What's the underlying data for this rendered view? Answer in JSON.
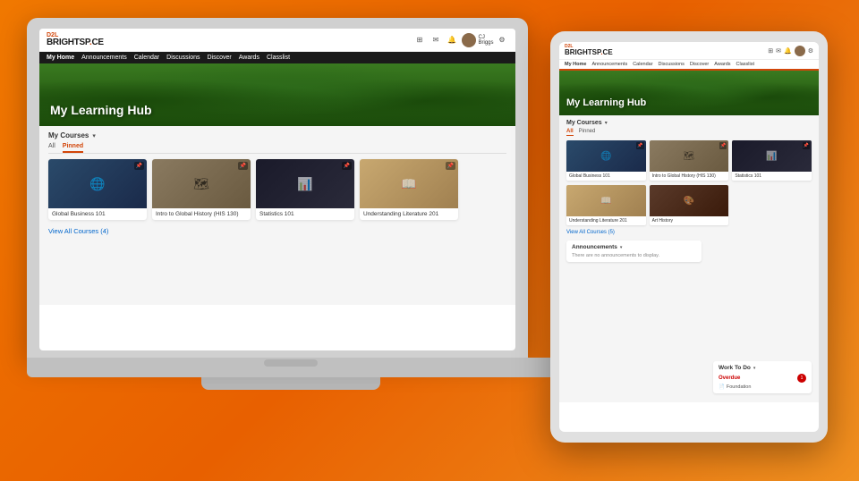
{
  "background": {
    "color": "#f07800"
  },
  "laptop": {
    "header": {
      "logo_d2l": "D2L",
      "logo_name": "BRIGHTSP",
      "logo_dot": ".",
      "logo_ce": "CE",
      "icons": [
        "grid",
        "mail",
        "bell",
        "avatar",
        "gear"
      ]
    },
    "nav": {
      "items": [
        "My Home",
        "Announcements",
        "Calendar",
        "Discussions",
        "Discover",
        "Awards",
        "Classlist"
      ]
    },
    "hero": {
      "title": "My Learning Hub"
    },
    "courses": {
      "section_title": "My Courses",
      "tabs": [
        "All",
        "Pinned"
      ],
      "active_tab": "Pinned",
      "items": [
        {
          "name": "Global Business 101",
          "thumb": "business"
        },
        {
          "name": "Intro to Global History (HIS 130)",
          "thumb": "history"
        },
        {
          "name": "Statistics 101",
          "thumb": "stats"
        },
        {
          "name": "Understanding Literature 201",
          "thumb": "literature"
        }
      ],
      "view_all": "View All Courses (4)"
    }
  },
  "tablet": {
    "header": {
      "logo_d2l": "D2L",
      "logo_name": "BRIGHTSP",
      "logo_dot": ".",
      "logo_ce": "CE",
      "icons": [
        "grid",
        "mail",
        "bell",
        "avatar",
        "gear"
      ]
    },
    "nav": {
      "items": [
        "My Home",
        "Announcements",
        "Calendar",
        "Discussions",
        "Discover",
        "Awards",
        "Classlist"
      ]
    },
    "hero": {
      "title": "My Learning Hub"
    },
    "courses": {
      "section_title": "My Courses",
      "tabs": [
        "All",
        "Pinned"
      ],
      "active_tab": "All",
      "row1": [
        {
          "name": "Global Business 101",
          "thumb": "business"
        },
        {
          "name": "Intro to Global History (HIS 130)",
          "thumb": "history"
        },
        {
          "name": "Statistics 101",
          "thumb": "stats"
        }
      ],
      "row2": [
        {
          "name": "Understanding Literature 201",
          "thumb": "literature"
        },
        {
          "name": "Art History",
          "thumb": "art"
        }
      ],
      "view_all": "View All Courses (5)"
    },
    "announcements": {
      "title": "Announcements",
      "empty_text": "There are no announcements to display."
    },
    "work_todo": {
      "title": "Work To Do",
      "overdue_label": "Overdue",
      "overdue_count": "1",
      "item": "Foundation"
    }
  }
}
